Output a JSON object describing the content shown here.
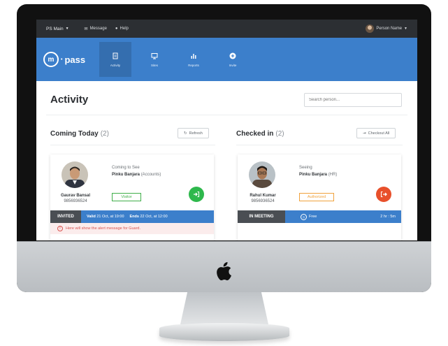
{
  "topbar": {
    "location": "PS Main",
    "message_label": "Message",
    "help_label": "Help",
    "user_name": "Person Name"
  },
  "nav": {
    "brand": "pass",
    "brand_letter": "m",
    "items": [
      {
        "label": "Activity",
        "icon": "document-icon",
        "active": true
      },
      {
        "label": "Sites",
        "icon": "monitor-icon",
        "active": false
      },
      {
        "label": "Reports",
        "icon": "bar-chart-icon",
        "active": false
      },
      {
        "label": "Invite",
        "icon": "plus-circle-icon",
        "active": false
      }
    ]
  },
  "page": {
    "title": "Activity",
    "search_placeholder": "Search person..."
  },
  "coming_today": {
    "title": "Coming Today",
    "count": "(2)",
    "refresh_label": "Refresh",
    "card": {
      "name": "Gaurav Bansal",
      "phone": "9856936524",
      "visit_label": "Coming to See",
      "host_name": "Pinku Banjara",
      "host_dept": "(Accounts)",
      "tag": "Visitor",
      "status": "INVITED",
      "valid_label": "Valid",
      "valid_value": "21 Oct, at 19:00",
      "ends_label": "Ends",
      "ends_value": "22 Oct, at 12:00",
      "alert": "Here will show the alert message for Guard."
    }
  },
  "checked_in": {
    "title": "Checked in",
    "count": "(2)",
    "checkout_label": "Checkout All",
    "card": {
      "name": "Rahul Kumar",
      "phone": "9856936524",
      "visit_label": "Seeing",
      "host_name": "Pinku Banjara",
      "host_dept": "(HR)",
      "tag": "Authorized",
      "status": "IN MEETING",
      "mode": "Free",
      "duration": "2 hr : 5m"
    }
  },
  "colors": {
    "brand_blue": "#3c7fcb",
    "topbar": "#2c2f33",
    "enter_green": "#2eb84c",
    "exit_red": "#e8502b",
    "visitor_tag": "#3fae49",
    "authorized_tag": "#f0a23c"
  }
}
